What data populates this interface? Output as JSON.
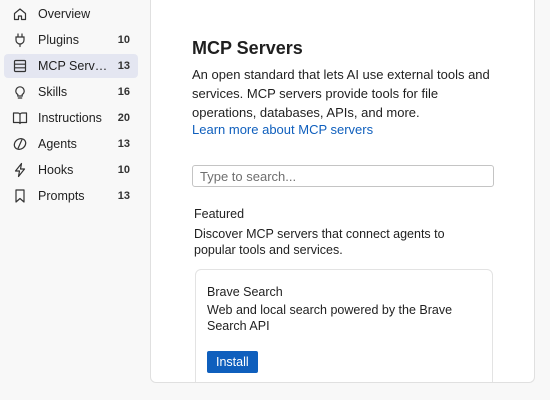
{
  "sidebar": {
    "items": [
      {
        "label": "Overview",
        "count": "",
        "icon": "home-icon"
      },
      {
        "label": "Plugins",
        "count": "10",
        "icon": "plug-icon"
      },
      {
        "label": "MCP Serv…",
        "count": "13",
        "icon": "server-icon",
        "active": true
      },
      {
        "label": "Skills",
        "count": "16",
        "icon": "lightbulb-icon"
      },
      {
        "label": "Instructions",
        "count": "20",
        "icon": "book-icon"
      },
      {
        "label": "Agents",
        "count": "13",
        "icon": "agent-icon"
      },
      {
        "label": "Hooks",
        "count": "10",
        "icon": "lightning-icon"
      },
      {
        "label": "Prompts",
        "count": "13",
        "icon": "bookmark-icon"
      }
    ]
  },
  "main": {
    "title": "MCP Servers",
    "description": "An open standard that lets AI use external tools and services. MCP servers provide tools for file operations, databases, APIs, and more.",
    "learn_more": "Learn more about MCP servers",
    "search_placeholder": "Type to search...",
    "featured": {
      "heading": "Featured",
      "description": "Discover MCP servers that connect agents to popular tools and services."
    },
    "card": {
      "title": "Brave Search",
      "description": "Web and local search powered by the Brave Search API",
      "install_label": "Install"
    }
  },
  "colors": {
    "accent": "#0f5fbd",
    "active_item_bg": "#e4e6f1"
  }
}
